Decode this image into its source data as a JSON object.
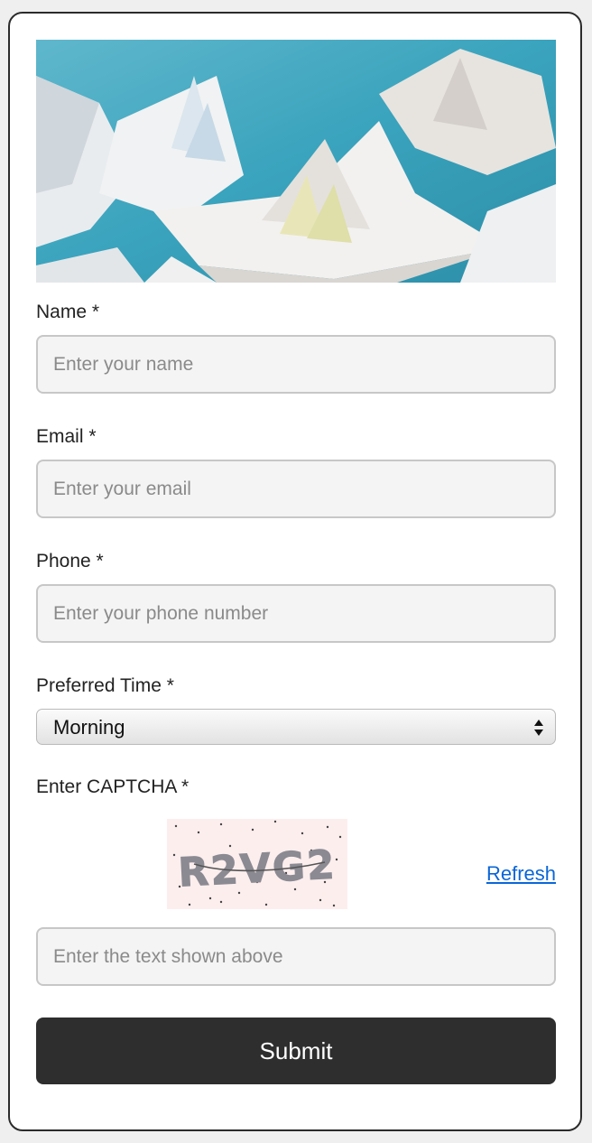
{
  "form": {
    "name": {
      "label": "Name *",
      "placeholder": "Enter your name"
    },
    "email": {
      "label": "Email *",
      "placeholder": "Enter your email"
    },
    "phone": {
      "label": "Phone *",
      "placeholder": "Enter your phone number"
    },
    "preferred_time": {
      "label": "Preferred Time *",
      "value": "Morning"
    },
    "captcha": {
      "label": "Enter CAPTCHA *",
      "code": "R2VG2",
      "refresh_label": "Refresh",
      "input_placeholder": "Enter the text shown above"
    },
    "submit_label": "Submit"
  },
  "colors": {
    "submit_bg": "#2e2e2e",
    "link": "#0a66d8",
    "hero_water": "#3aa3bd",
    "captcha_bg": "#fdeeee"
  }
}
